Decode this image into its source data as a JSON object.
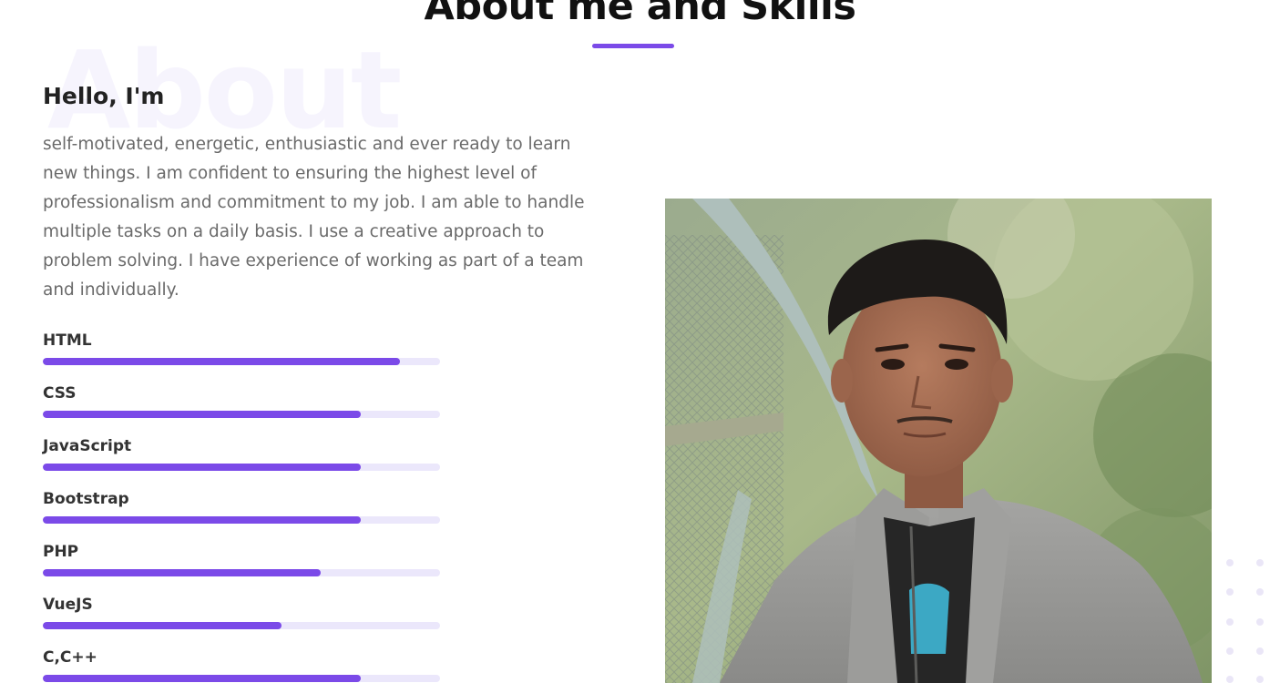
{
  "section": {
    "title": "About me and Skills",
    "watermark": "About"
  },
  "about": {
    "greeting": "Hello, I'm",
    "bio": "self-motivated, energetic, enthusiastic and ever ready to learn new things. I am confident to ensuring the highest level of professionalism and commitment to my job. I am able to handle multiple tasks on a daily basis. I use a creative approach to problem solving. I have experience of working as part of a team and individually."
  },
  "skills": [
    {
      "label": "HTML",
      "percent": 90
    },
    {
      "label": "CSS",
      "percent": 80
    },
    {
      "label": "JavaScript",
      "percent": 80
    },
    {
      "label": "Bootstrap",
      "percent": 80
    },
    {
      "label": "PHP",
      "percent": 70
    },
    {
      "label": "VueJS",
      "percent": 60
    },
    {
      "label": "C,C++",
      "percent": 80
    }
  ],
  "colors": {
    "accent": "#7b4ae8",
    "track": "#ebe7fb",
    "text": "#111111",
    "muted": "#6a6a6a"
  },
  "icons": {
    "decoration": "dot-grid-icon"
  }
}
